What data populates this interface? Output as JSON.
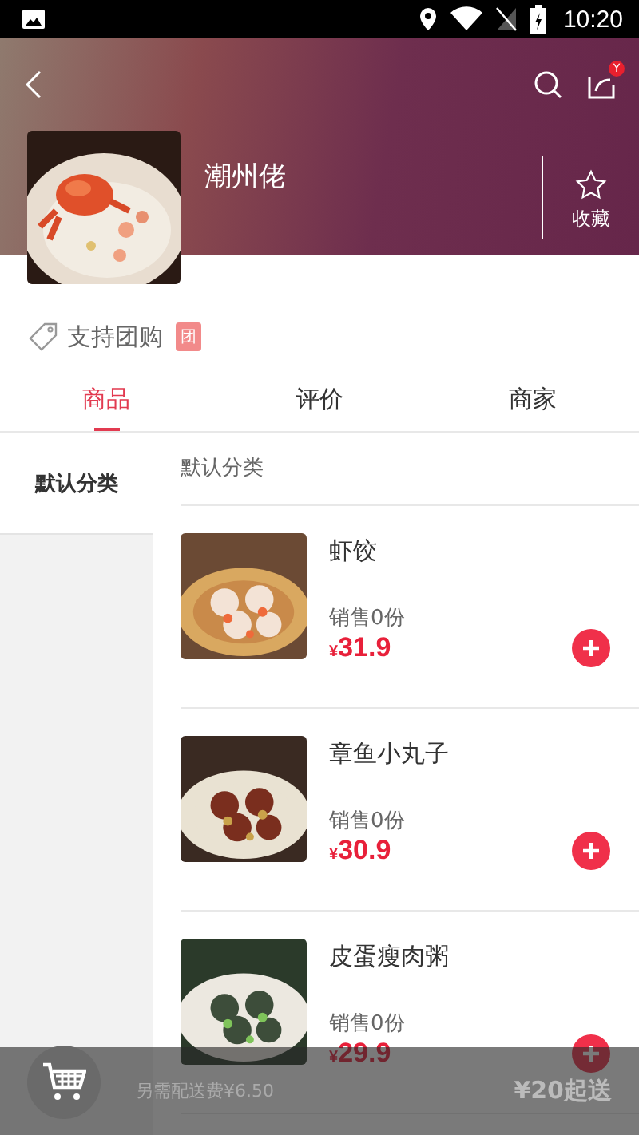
{
  "status_bar": {
    "time": "10:20"
  },
  "store": {
    "name": "潮州佬",
    "favorite_label": "收藏",
    "favorited": false,
    "notification_badge": "Y"
  },
  "group_buy": {
    "label": "支持团购",
    "badge": "团"
  },
  "tabs": [
    {
      "label": "商品",
      "selected": true
    },
    {
      "label": "评价",
      "selected": false
    },
    {
      "label": "商家",
      "selected": false
    }
  ],
  "categories": [
    {
      "label": "默认分类",
      "selected": true
    }
  ],
  "section_title": "默认分类",
  "products": [
    {
      "name": "虾饺",
      "sales": "销售0份",
      "currency": "¥",
      "price": "31.9"
    },
    {
      "name": "章鱼小丸子",
      "sales": "销售0份",
      "currency": "¥",
      "price": "30.9"
    },
    {
      "name": "皮蛋瘦肉粥",
      "sales": "销售0份",
      "currency": "¥",
      "price": "29.9"
    }
  ],
  "cart": {
    "delivery_fee": "另需配送费¥6.50",
    "minimum": "¥20起送"
  }
}
